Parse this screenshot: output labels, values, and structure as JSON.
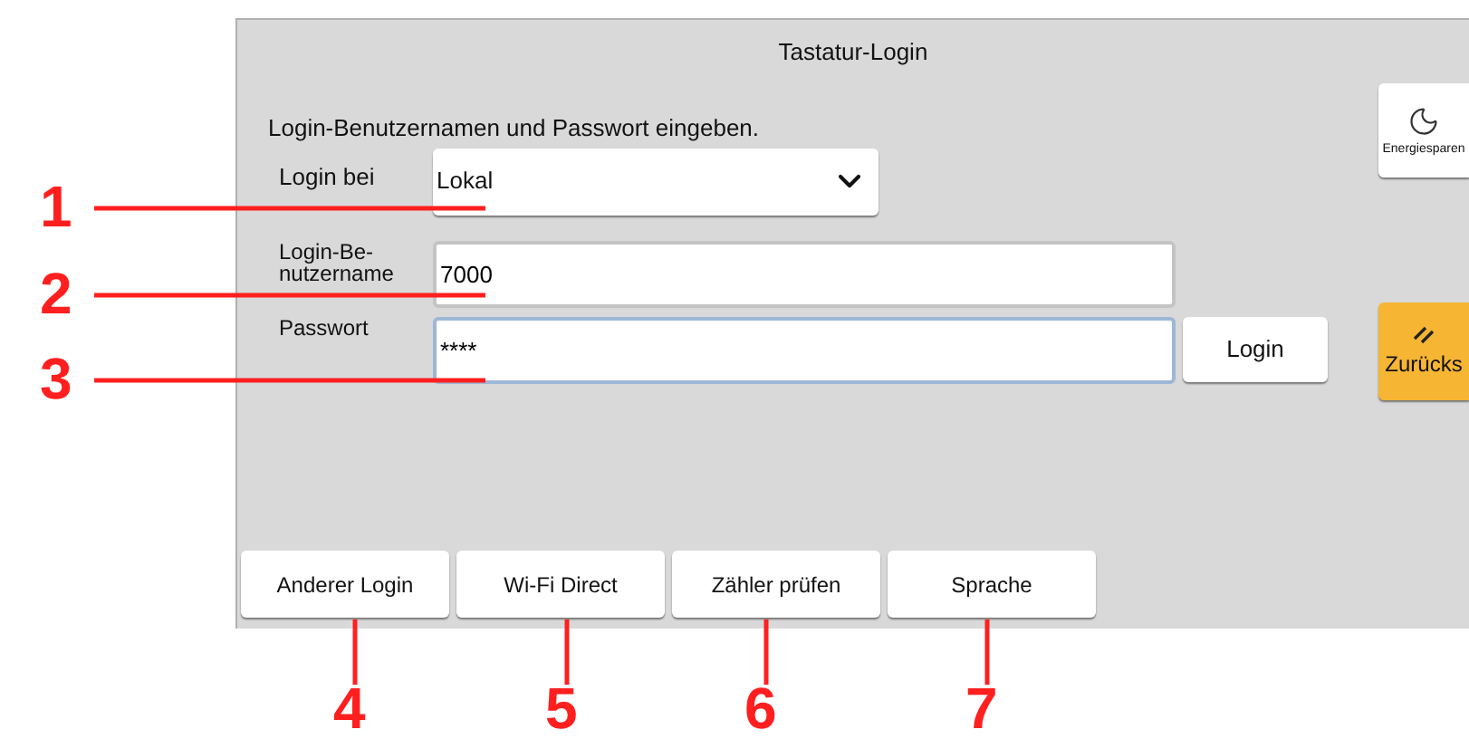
{
  "screen": {
    "title": "Tastatur-Login",
    "instruction": "Login-Benutzernamen und Passwort eingeben.",
    "login_at": {
      "label": "Login bei",
      "value": "Lokal"
    },
    "username": {
      "label": "Login-Be-\nnutzername",
      "value": "7000",
      "focused": false
    },
    "password": {
      "label": "Passwort",
      "value": "****",
      "focused": true
    },
    "login_button": "Login",
    "energy_button": "Energiesparen",
    "reset_button": "Zurücks",
    "bottom_buttons": [
      "Anderer Login",
      "Wi-Fi Direct",
      "Zähler prüfen",
      "Sprache"
    ]
  },
  "callouts": [
    {
      "label": "1"
    },
    {
      "label": "2"
    },
    {
      "label": "3"
    },
    {
      "label": "4"
    },
    {
      "label": "5"
    },
    {
      "label": "6"
    },
    {
      "label": "7"
    }
  ]
}
